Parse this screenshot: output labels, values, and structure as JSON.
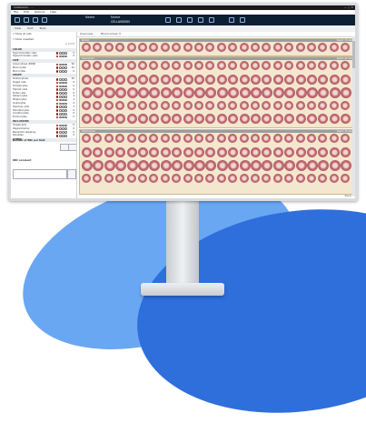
{
  "window": {
    "title": "Cellavision - ...",
    "controls": "—  ▢  ✕"
  },
  "menu": [
    "File",
    "Edit",
    "Options",
    "Help"
  ],
  "toolbar": {
    "name": "Name",
    "patient": "Name",
    "id": "CELLAVISION"
  },
  "subbar": [
    "View",
    "Sort",
    "Tools"
  ],
  "cells_header": [
    "Overview",
    "Blood smear  ✕"
  ],
  "left_panel": {
    "checks": [
      "Show all cells",
      "Show classified"
    ],
    "col_header": "A  C  D  E",
    "sections": [
      {
        "title": "COLOR",
        "rows": [
          {
            "label": "Hypochromatic cells",
            "count": "0"
          },
          {
            "label": "Hyperchromatic cells",
            "count": "0"
          }
        ]
      },
      {
        "title": "SIZE",
        "rows": [
          {
            "label": "Anisocytosis (RDW)",
            "count": "62"
          },
          {
            "label": "Macrocytes",
            "count": "10"
          },
          {
            "label": "Microcytes",
            "count": "0"
          }
        ]
      },
      {
        "title": "SHAPE",
        "rows": [
          {
            "label": "Poikilocytosis",
            "count": "26"
          },
          {
            "label": "Target cells",
            "count": "6"
          },
          {
            "label": "Schistocytes",
            "count": "0"
          },
          {
            "label": "Helmet cells",
            "count": "0"
          },
          {
            "label": "Sickle cells",
            "count": "0"
          },
          {
            "label": "Spherocytes",
            "count": "4"
          },
          {
            "label": "Elliptocytes",
            "count": "2"
          },
          {
            "label": "Ovalocytes",
            "count": "0"
          },
          {
            "label": "Teardrop cells",
            "count": "3"
          },
          {
            "label": "Stomatocytes",
            "count": "0"
          },
          {
            "label": "Acanthocytes",
            "count": "0"
          },
          {
            "label": "Echinocytes",
            "count": "0"
          }
        ]
      },
      {
        "title": "INCLUSIONS",
        "rows": [
          {
            "label": "Howell-Jolly",
            "count": "0"
          },
          {
            "label": "Pappenheimer",
            "count": "0"
          },
          {
            "label": "Basophilic stippling",
            "count": "0"
          },
          {
            "label": "Parasites",
            "count": "0"
          }
        ]
      },
      {
        "title": "OTHER",
        "rows": []
      }
    ],
    "bottom_title": "Number of RBC per field",
    "bottom_title2": "RBC comment"
  },
  "groups": [
    {
      "label": "Normal",
      "right": "Report: 30 cells"
    },
    {
      "label": "Anisocytosis",
      "right": "Report: 64 cells"
    },
    {
      "label": "Poikilocytosis",
      "right": "Report: 26 cells"
    }
  ],
  "status": "Ready"
}
